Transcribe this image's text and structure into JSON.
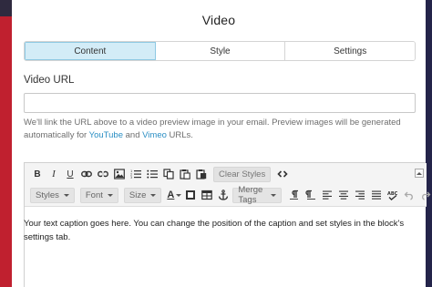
{
  "panel": {
    "title": "Video",
    "tabs": [
      {
        "label": "Content",
        "active": true
      },
      {
        "label": "Style",
        "active": false
      },
      {
        "label": "Settings",
        "active": false
      }
    ]
  },
  "video_url": {
    "label": "Video URL",
    "value": "",
    "placeholder": ""
  },
  "help": {
    "text_before": "We'll link the URL above to a video preview image in your email. Preview images will be generated automatically for ",
    "link_youtube": "YouTube",
    "text_and": " and ",
    "link_vimeo": "Vimeo",
    "text_after": " URLs."
  },
  "toolbar": {
    "clear_styles": "Clear Styles",
    "styles": "Styles",
    "font": "Font",
    "size": "Size",
    "merge_tags": "Merge Tags",
    "bold": "B",
    "italic": "I",
    "underline": "U",
    "text_color": "A"
  },
  "editor": {
    "caption": "Your text caption goes here. You can change the position of the caption and set styles in the block's settings tab."
  },
  "colors": {
    "accent_tab": "#d3ecf7",
    "link": "#2b8fc4",
    "left_strip": "#c0202f",
    "right_strip": "#24244a"
  }
}
